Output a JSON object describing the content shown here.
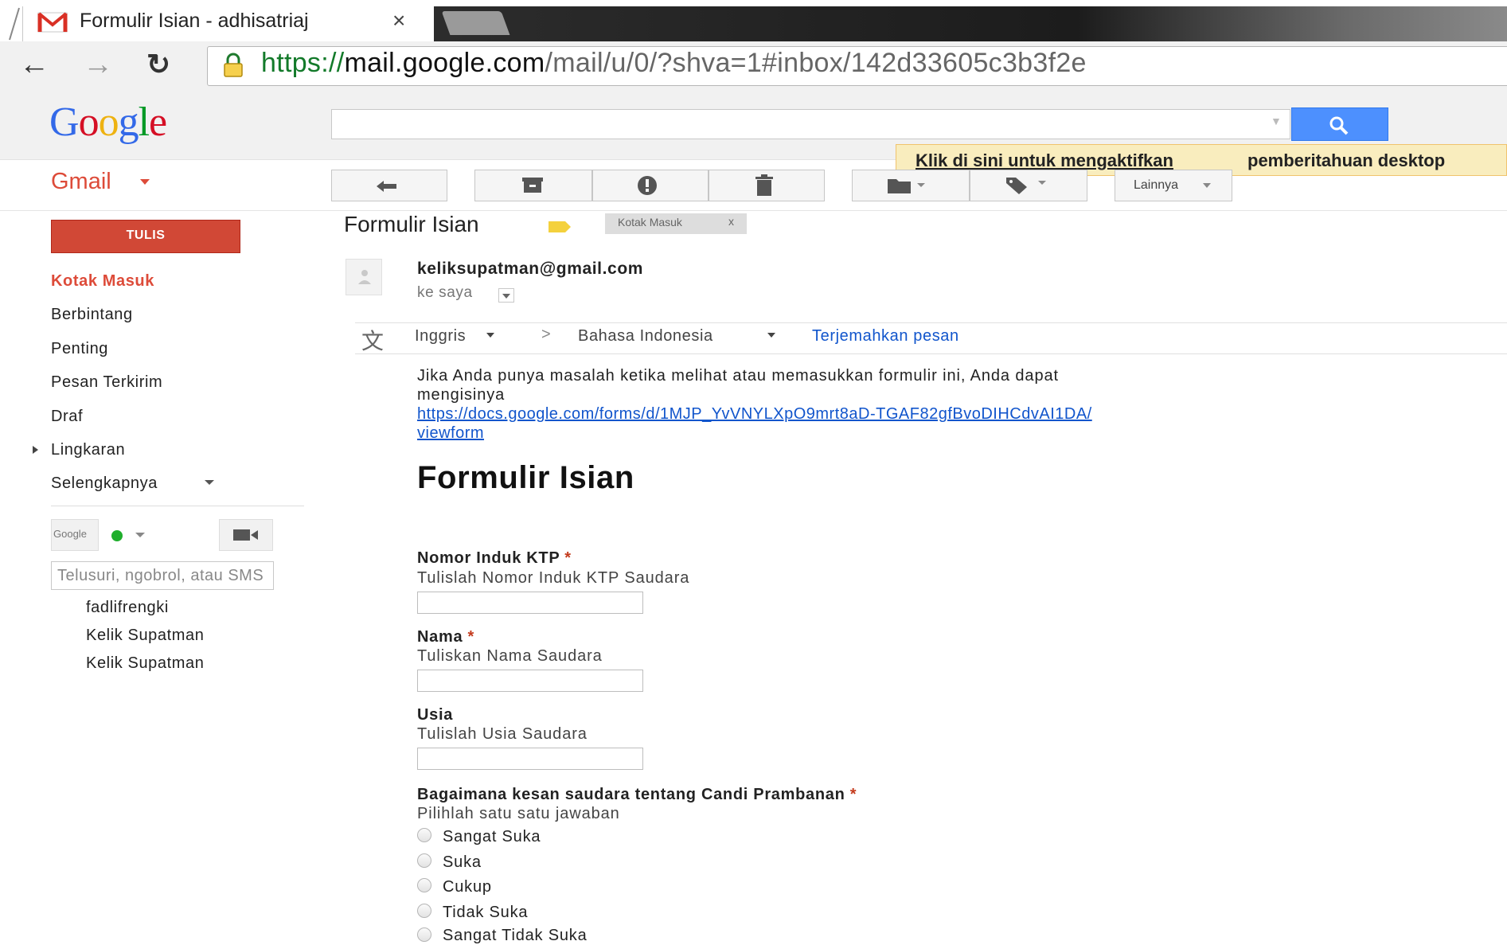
{
  "browser": {
    "tab_title": "Formulir Isian - adhisatriaj",
    "tab_close": "×",
    "url_scheme": "https://",
    "url_host": "mail.google.com",
    "url_path": "/mail/u/0/?shva=1#inbox/142d33605c3b3f2e"
  },
  "header": {
    "logo": [
      "G",
      "o",
      "o",
      "g",
      "l",
      "e"
    ],
    "logo_colors": [
      "#3369e8",
      "#d50f25",
      "#eeb211",
      "#3369e8",
      "#009925",
      "#d50f25"
    ],
    "search_value": "",
    "notification_link": "Klik di sini untuk mengaktifkan",
    "notification_rest": "pemberitahuan desktop"
  },
  "app": {
    "name": "Gmail",
    "accent": "#dd4b39"
  },
  "toolbar": {
    "more_label": "Lainnya"
  },
  "sidebar": {
    "compose_label": "TULIS",
    "items": [
      "Kotak Masuk",
      "Berbintang",
      "Penting",
      "Pesan Terkirim",
      "Draf",
      "Lingkaran",
      "Selengkapnya"
    ]
  },
  "chat": {
    "google_label": "Google",
    "search_placeholder": "Telusuri, ngobrol, atau SMS",
    "contacts": [
      "fadlifrengki",
      "Kelik Supatman",
      "Kelik Supatman"
    ]
  },
  "message": {
    "subject": "Formulir Isian",
    "label": "Kotak Masuk",
    "label_remove": "x",
    "sender": "keliksupatman@gmail.com",
    "to": "ke saya",
    "translate_from": "Inggris",
    "translate_arrow": ">",
    "translate_to": "Bahasa Indonesia",
    "translate_link": "Terjemahkan pesan",
    "intro_line1": "Jika Anda punya masalah ketika melihat atau memasukkan formulir ini, Anda dapat",
    "intro_line2": "mengisinya",
    "link_line1": "https://docs.google.com/forms/d/1MJP_YvVNYLXpO9mrt8aD-TGAF82gfBvoDIHCdvAI1DA/",
    "link_line2": "viewform"
  },
  "form": {
    "title": "Formulir Isian",
    "required_mark": "*",
    "questions": [
      {
        "label": "Nomor Induk KTP",
        "required": true,
        "help": "Tulislah Nomor Induk KTP Saudara",
        "value": ""
      },
      {
        "label": "Nama",
        "required": true,
        "help": "Tuliskan Nama Saudara",
        "value": ""
      },
      {
        "label": "Usia",
        "required": false,
        "help": "Tulislah Usia Saudara",
        "value": ""
      }
    ],
    "choice_question": {
      "label": "Bagaimana kesan saudara tentang Candi Prambanan",
      "help": "Pilihlah satu satu jawaban",
      "options": [
        "Sangat Suka",
        "Suka",
        "Cukup",
        "Tidak Suka",
        "Sangat Tidak Suka"
      ]
    }
  }
}
